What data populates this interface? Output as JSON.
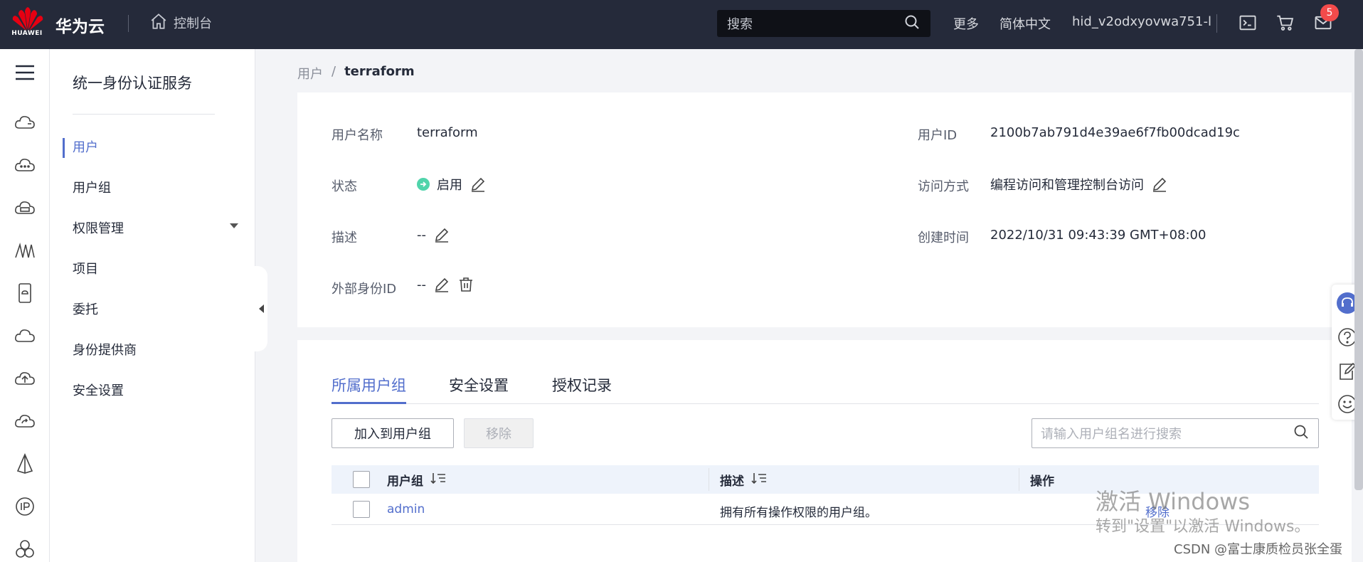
{
  "topbar": {
    "logo_text": "HUAWEI",
    "brand": "华为云",
    "console": "控制台",
    "search_placeholder": "搜索",
    "more": "更多",
    "language": "简体中文",
    "username": "hid_v2odxyovwa751-l",
    "mail_badge": "5",
    "accent": "#526ecc",
    "icons": [
      "home-icon",
      "search-icon",
      "terminal-icon",
      "cart-icon",
      "mail-icon"
    ]
  },
  "rail": {
    "icons": [
      "menu-icon",
      "cloud-server-icon",
      "cloud-more-icon",
      "cloud-storage-icon",
      "network-icon",
      "phone-cloud-icon",
      "cloud-icon",
      "cloud-upload-icon",
      "cloud-refresh-icon",
      "tower-icon",
      "ip-icon",
      "cluster-icon"
    ]
  },
  "sidebar": {
    "title": "统一身份认证服务",
    "items": [
      {
        "label": "用户",
        "active": true
      },
      {
        "label": "用户组"
      },
      {
        "label": "权限管理"
      },
      {
        "label": "项目"
      },
      {
        "label": "委托"
      },
      {
        "label": "身份提供商"
      },
      {
        "label": "安全设置"
      }
    ]
  },
  "breadcrumb": {
    "parent": "用户",
    "separator": "/",
    "current": "terraform"
  },
  "detail": {
    "username_label": "用户名称",
    "username_value": "terraform",
    "status_label": "状态",
    "status_value": "启用",
    "status_color": "#50d4ab",
    "desc_label": "描述",
    "desc_value": "--",
    "external_id_label": "外部身份ID",
    "external_id_value": "--",
    "user_id_label": "用户ID",
    "user_id_value": "2100b7ab791d4e39ae6f7fb00dcad19c",
    "access_label": "访问方式",
    "access_value": "编程访问和管理控制台访问",
    "created_label": "创建时间",
    "created_value": "2022/10/31 09:43:39 GMT+08:00"
  },
  "tabs": [
    {
      "label": "所属用户组",
      "active": true
    },
    {
      "label": "安全设置"
    },
    {
      "label": "授权记录"
    }
  ],
  "actions": {
    "add_to_group": "加入到用户组",
    "remove": "移除",
    "group_search_placeholder": "请输入用户组名进行搜索"
  },
  "table": {
    "headers": [
      "用户组",
      "描述",
      "操作"
    ],
    "rows": [
      {
        "group": "admin",
        "description": "拥有所有操作权限的用户组。",
        "action": "移除"
      }
    ]
  },
  "overlay": {
    "watermark_title": "激活 Windows",
    "watermark_sub": "转到\"设置\"以激活 Windows。",
    "csdn": "CSDN @富士康质检员张全蛋"
  }
}
